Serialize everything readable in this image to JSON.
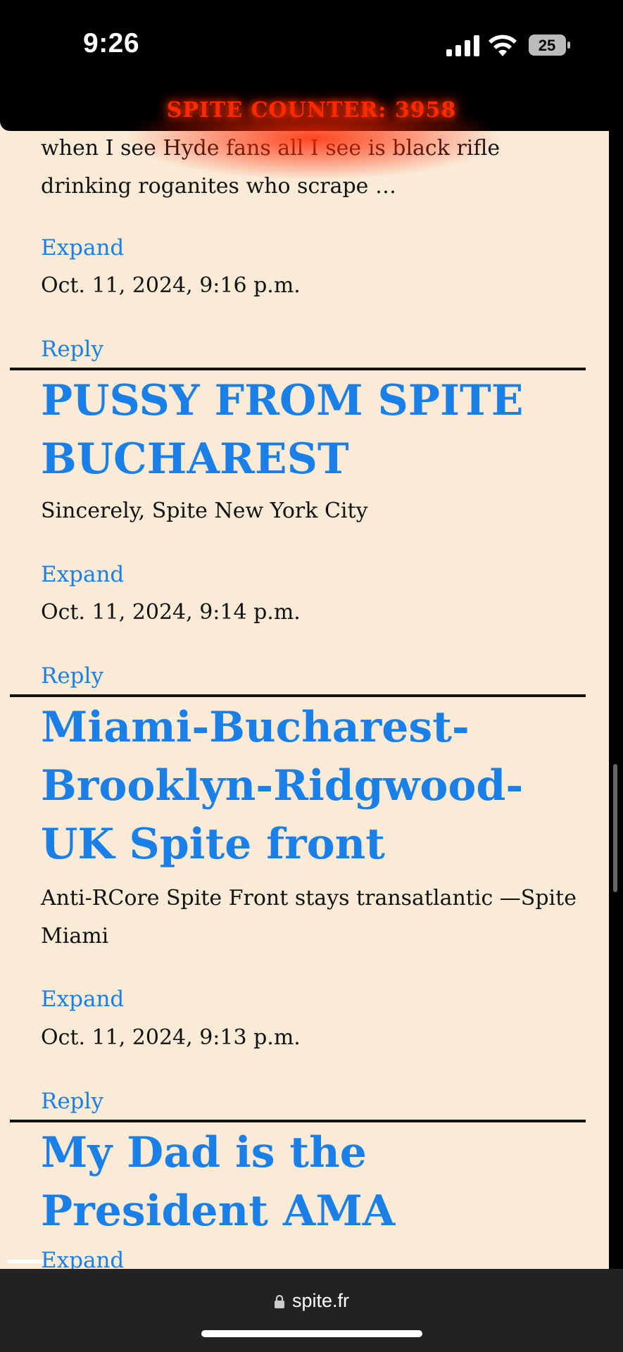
{
  "status": {
    "time": "9:26",
    "battery": "25"
  },
  "counter": {
    "text": "SPITE COUNTER: 3958"
  },
  "posts": [
    {
      "excerpt": "when I see Hyde fans all I see is black rifle drinking roganites who scrape …",
      "expand": "Expand",
      "date": "Oct. 11, 2024, 9:16 p.m.",
      "reply": "Reply"
    },
    {
      "title": "PUSSY FROM SPITE BUCHAREST",
      "excerpt": "Sincerely, Spite New York City",
      "expand": "Expand",
      "date": "Oct. 11, 2024, 9:14 p.m.",
      "reply": "Reply"
    },
    {
      "title": "Miami-Bucharest-Brooklyn-Ridgwood-UK Spite front",
      "excerpt": "Anti-RCore Spite Front stays transatlantic —Spite Miami",
      "expand": "Expand",
      "date": "Oct. 11, 2024, 9:13 p.m.",
      "reply": "Reply"
    },
    {
      "title": "My Dad is the President AMA",
      "expand": "Expand"
    }
  ],
  "browser": {
    "url": "spite.fr"
  },
  "colors": {
    "link": "#1a7fe6",
    "page_bg": "#faebd7",
    "counter": "#ff2a00"
  }
}
